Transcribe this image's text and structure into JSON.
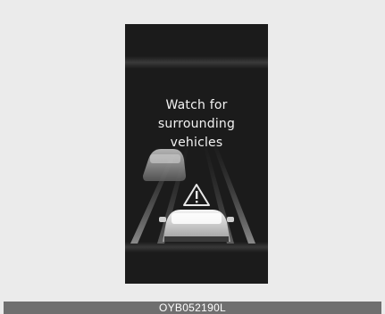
{
  "message": {
    "line1": "Watch for",
    "line2": "surrounding",
    "line3": "vehicles"
  },
  "caption": "OYB052190L",
  "icons": {
    "warning": "warning-triangle-icon",
    "adjacent_vehicle": "vehicle-left-rear-icon",
    "own_vehicle": "own-vehicle-icon"
  },
  "colors": {
    "background": "#ebebeb",
    "display": "#1b1b1b",
    "caption_bar": "#6f6f6f",
    "text": "#f2f2f2"
  }
}
